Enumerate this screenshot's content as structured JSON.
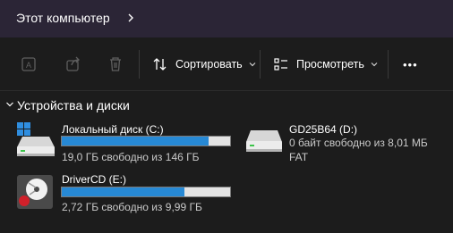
{
  "address": {
    "location": "Этот компьютер"
  },
  "toolbar": {
    "sort_label": "Сортировать",
    "view_label": "Просмотреть",
    "more_label": "•••"
  },
  "section": {
    "title": "Устройства и диски"
  },
  "drives": [
    {
      "name": "Локальный диск (C:)",
      "free_text": "19,0 ГБ свободно из 146 ГБ",
      "used_fraction": 0.87,
      "icon": "windows-drive-icon"
    },
    {
      "name": "GD25B64 (D:)",
      "free_text": "0 байт свободно из 8,01 МБ",
      "filesystem": "FAT",
      "icon": "drive-icon"
    },
    {
      "name": "DriverCD (E:)",
      "free_text": "2,72 ГБ свободно из 9,99 ГБ",
      "used_fraction": 0.73,
      "icon": "cd-drive-icon"
    }
  ],
  "colors": {
    "accent": "#2789d5",
    "address_bar": "#2b2536",
    "background": "#1c1c1c"
  }
}
